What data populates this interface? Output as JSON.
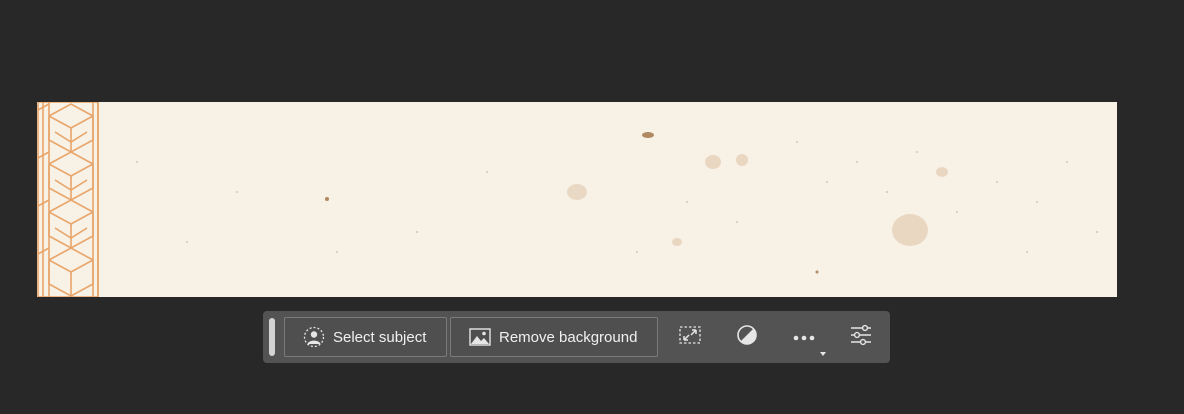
{
  "canvas": {
    "image_label": "document-canvas",
    "background_color": "#f8f1e6",
    "pattern_color": "#e8a56a"
  },
  "taskbar": {
    "background_color": "#535353",
    "select_subject_label": "Select subject",
    "select_subject_icon": "person-select-icon",
    "remove_background_label": "Remove background",
    "remove_background_icon": "image-icon",
    "transform_icon": "resize-selection-icon",
    "adjustment_icon": "contrast-icon",
    "more_icon": "more-options-icon",
    "settings_icon": "sliders-icon"
  }
}
